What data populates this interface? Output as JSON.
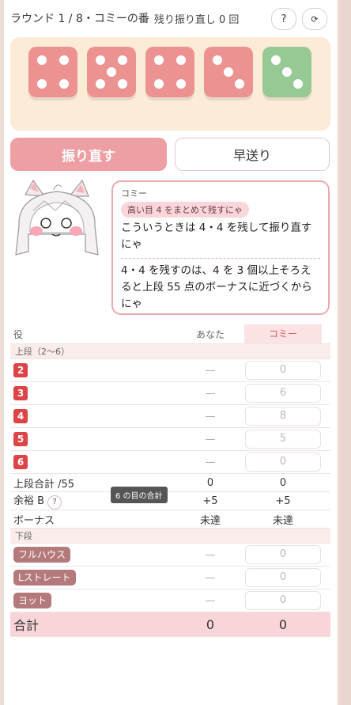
{
  "header": {
    "title": "ラウンド 1 / 8・コミーの番",
    "rerolls_left": "残り振り直し 0 回",
    "help_label": "?",
    "refresh_icon": "refresh-icon"
  },
  "dice": [
    {
      "value": 4,
      "color": "#ec9391"
    },
    {
      "value": 5,
      "color": "#ec9391"
    },
    {
      "value": 4,
      "color": "#ec9391"
    },
    {
      "value": 3,
      "color": "#ec9391"
    },
    {
      "value": 3,
      "color": "#97c994"
    }
  ],
  "buttons": {
    "reroll": "振り直す",
    "fast_forward": "早送り"
  },
  "bubble": {
    "speaker": "コミー",
    "tag": "高い目 4 をまとめて残すにゃ",
    "message": "こういうときは 4・4 を残して振り直すにゃ",
    "explanation": "4・4 を残すのは、4 を 3 個以上そろえると上段 55 点のボーナスに近づくからにゃ"
  },
  "table": {
    "headers": {
      "role": "役",
      "you": "あなた",
      "cpu": "コミー"
    },
    "upper_section": "上段（2〜6）",
    "upper_rows": [
      {
        "label": "2",
        "you": "—",
        "cpu": "0"
      },
      {
        "label": "3",
        "you": "—",
        "cpu": "6"
      },
      {
        "label": "4",
        "you": "—",
        "cpu": "8"
      },
      {
        "label": "5",
        "you": "—",
        "cpu": "5"
      },
      {
        "label": "6",
        "you": "—",
        "cpu": "0"
      }
    ],
    "upper_total": {
      "label": "上段合計 /55",
      "you": "0",
      "cpu": "0"
    },
    "margin": {
      "label": "余裕 B",
      "help": "?",
      "you": "+5",
      "cpu": "+5"
    },
    "bonus": {
      "label": "ボーナス",
      "you": "未達",
      "cpu": "未達"
    },
    "lower_section": "下段",
    "lower_rows": [
      {
        "label": "フルハウス",
        "you": "—",
        "cpu": "0"
      },
      {
        "label": "Lストレート",
        "you": "—",
        "cpu": "0"
      },
      {
        "label": "ヨット",
        "you": "—",
        "cpu": "0"
      }
    ],
    "total": {
      "label": "合計",
      "you": "0",
      "cpu": "0"
    }
  },
  "tooltip": "6 の目の合計"
}
